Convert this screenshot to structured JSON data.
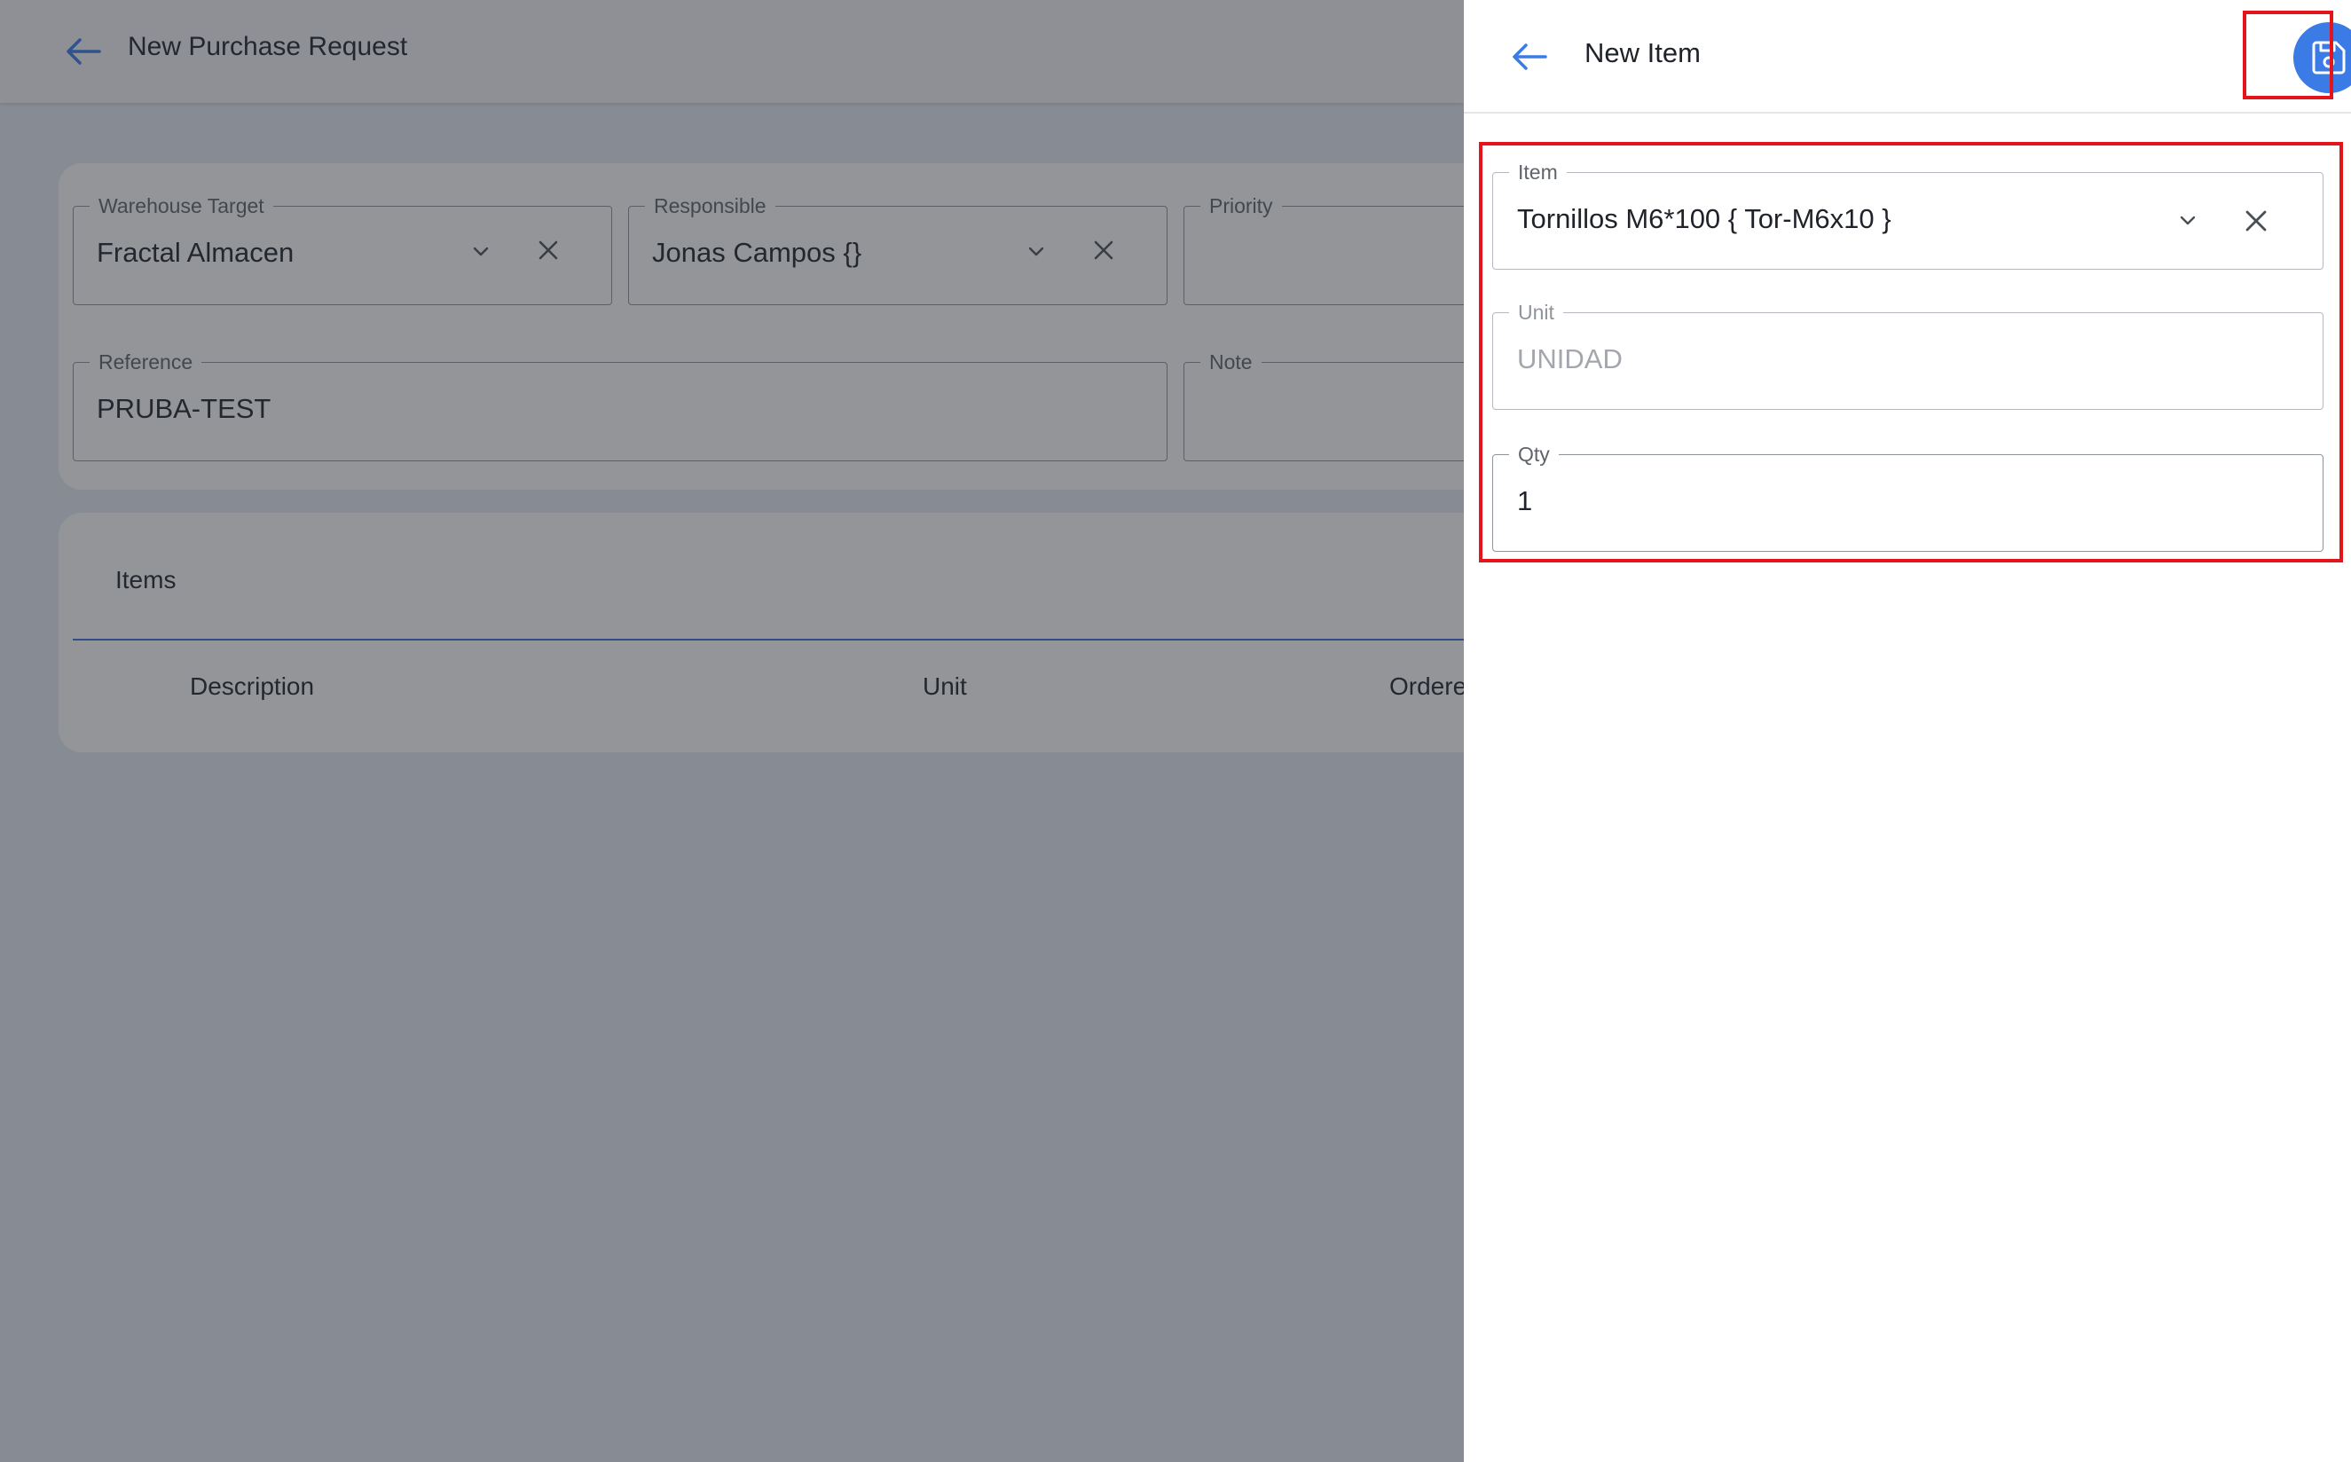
{
  "background": {
    "title": "New Purchase Request",
    "fields": {
      "warehouse_target": {
        "label": "Warehouse Target",
        "value": "Fractal Almacen"
      },
      "responsible": {
        "label": "Responsible",
        "value": "Jonas Campos {}"
      },
      "priority": {
        "label": "Priority",
        "value": ""
      },
      "reference": {
        "label": "Reference",
        "value": "PRUBA-TEST"
      },
      "note": {
        "label": "Note",
        "value": ""
      }
    },
    "items_tab": "Items",
    "columns": {
      "description": "Description",
      "unit": "Unit",
      "ordered": "Ordere"
    }
  },
  "dialog": {
    "title": "New Item",
    "item": {
      "label": "Item",
      "value": "Tornillos M6*100  { Tor-M6x10 }"
    },
    "unit": {
      "label": "Unit",
      "value": "UNIDAD"
    },
    "qty": {
      "label": "Qty",
      "value": "1"
    }
  },
  "colors": {
    "accent": "#3b7be6",
    "highlight": "#e5141b",
    "scrim": "#747983"
  },
  "icons": [
    "back-arrow-icon",
    "chevron-down-icon",
    "close-icon",
    "save-icon"
  ]
}
